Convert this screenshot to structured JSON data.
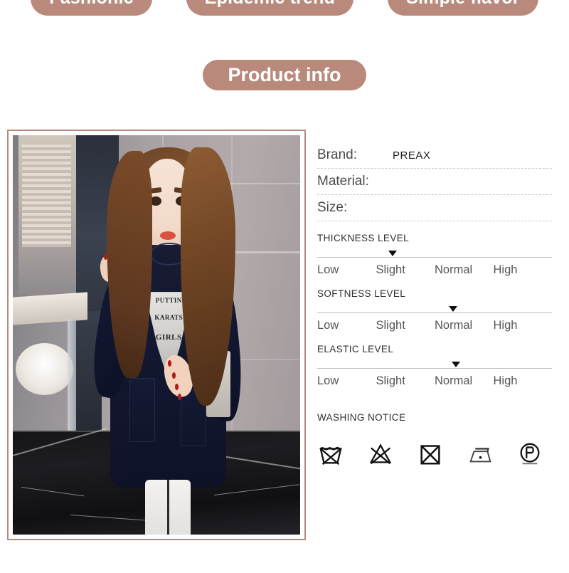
{
  "top_pills": [
    {
      "label": "Fashionic"
    },
    {
      "label": "Epidemic trend"
    },
    {
      "label": "Simple flavor"
    }
  ],
  "heading": {
    "label": "Product info"
  },
  "photo": {
    "graphic_text_line1": "PUTTIN",
    "graphic_text_line2": "KARATS",
    "graphic_text_line3": "GIRLS"
  },
  "specs": [
    {
      "label": "Brand:",
      "value": "PREAX"
    },
    {
      "label": "Material:",
      "value": ""
    },
    {
      "label": "Size:",
      "value": ""
    }
  ],
  "levels": [
    {
      "title": "THICKNESS LEVEL",
      "scale": [
        "Low",
        "Slight",
        "Normal",
        "High"
      ],
      "selected": "Slight",
      "marker_percent": 32
    },
    {
      "title": "SOFTNESS LEVEL",
      "scale": [
        "Low",
        "Slight",
        "Normal",
        "High"
      ],
      "selected": "Normal",
      "marker_percent": 58
    },
    {
      "title": "ELASTIC LEVEL",
      "scale": [
        "Low",
        "Slight",
        "Normal",
        "High"
      ],
      "selected": "Normal",
      "marker_percent": 59
    }
  ],
  "washing": {
    "title": "WASHING NOTICE",
    "icons": [
      {
        "name": "do-not-wash-icon",
        "meaning": "Do not wash"
      },
      {
        "name": "do-not-bleach-icon",
        "meaning": "Do not bleach"
      },
      {
        "name": "do-not-tumble-dry-icon",
        "meaning": "Do not tumble dry"
      },
      {
        "name": "iron-low-heat-icon",
        "meaning": "Iron low temperature"
      },
      {
        "name": "dry-clean-p-icon",
        "meaning": "Gentle dry clean with P solvent"
      }
    ]
  },
  "colors": {
    "pill": "#b98a7c",
    "pill_text": "#ffffff",
    "frame_border": "#b98a7c",
    "label_text": "#4a4a4a",
    "scale_text": "#555555",
    "divider": "#c9c9c9",
    "marker": "#111111"
  }
}
